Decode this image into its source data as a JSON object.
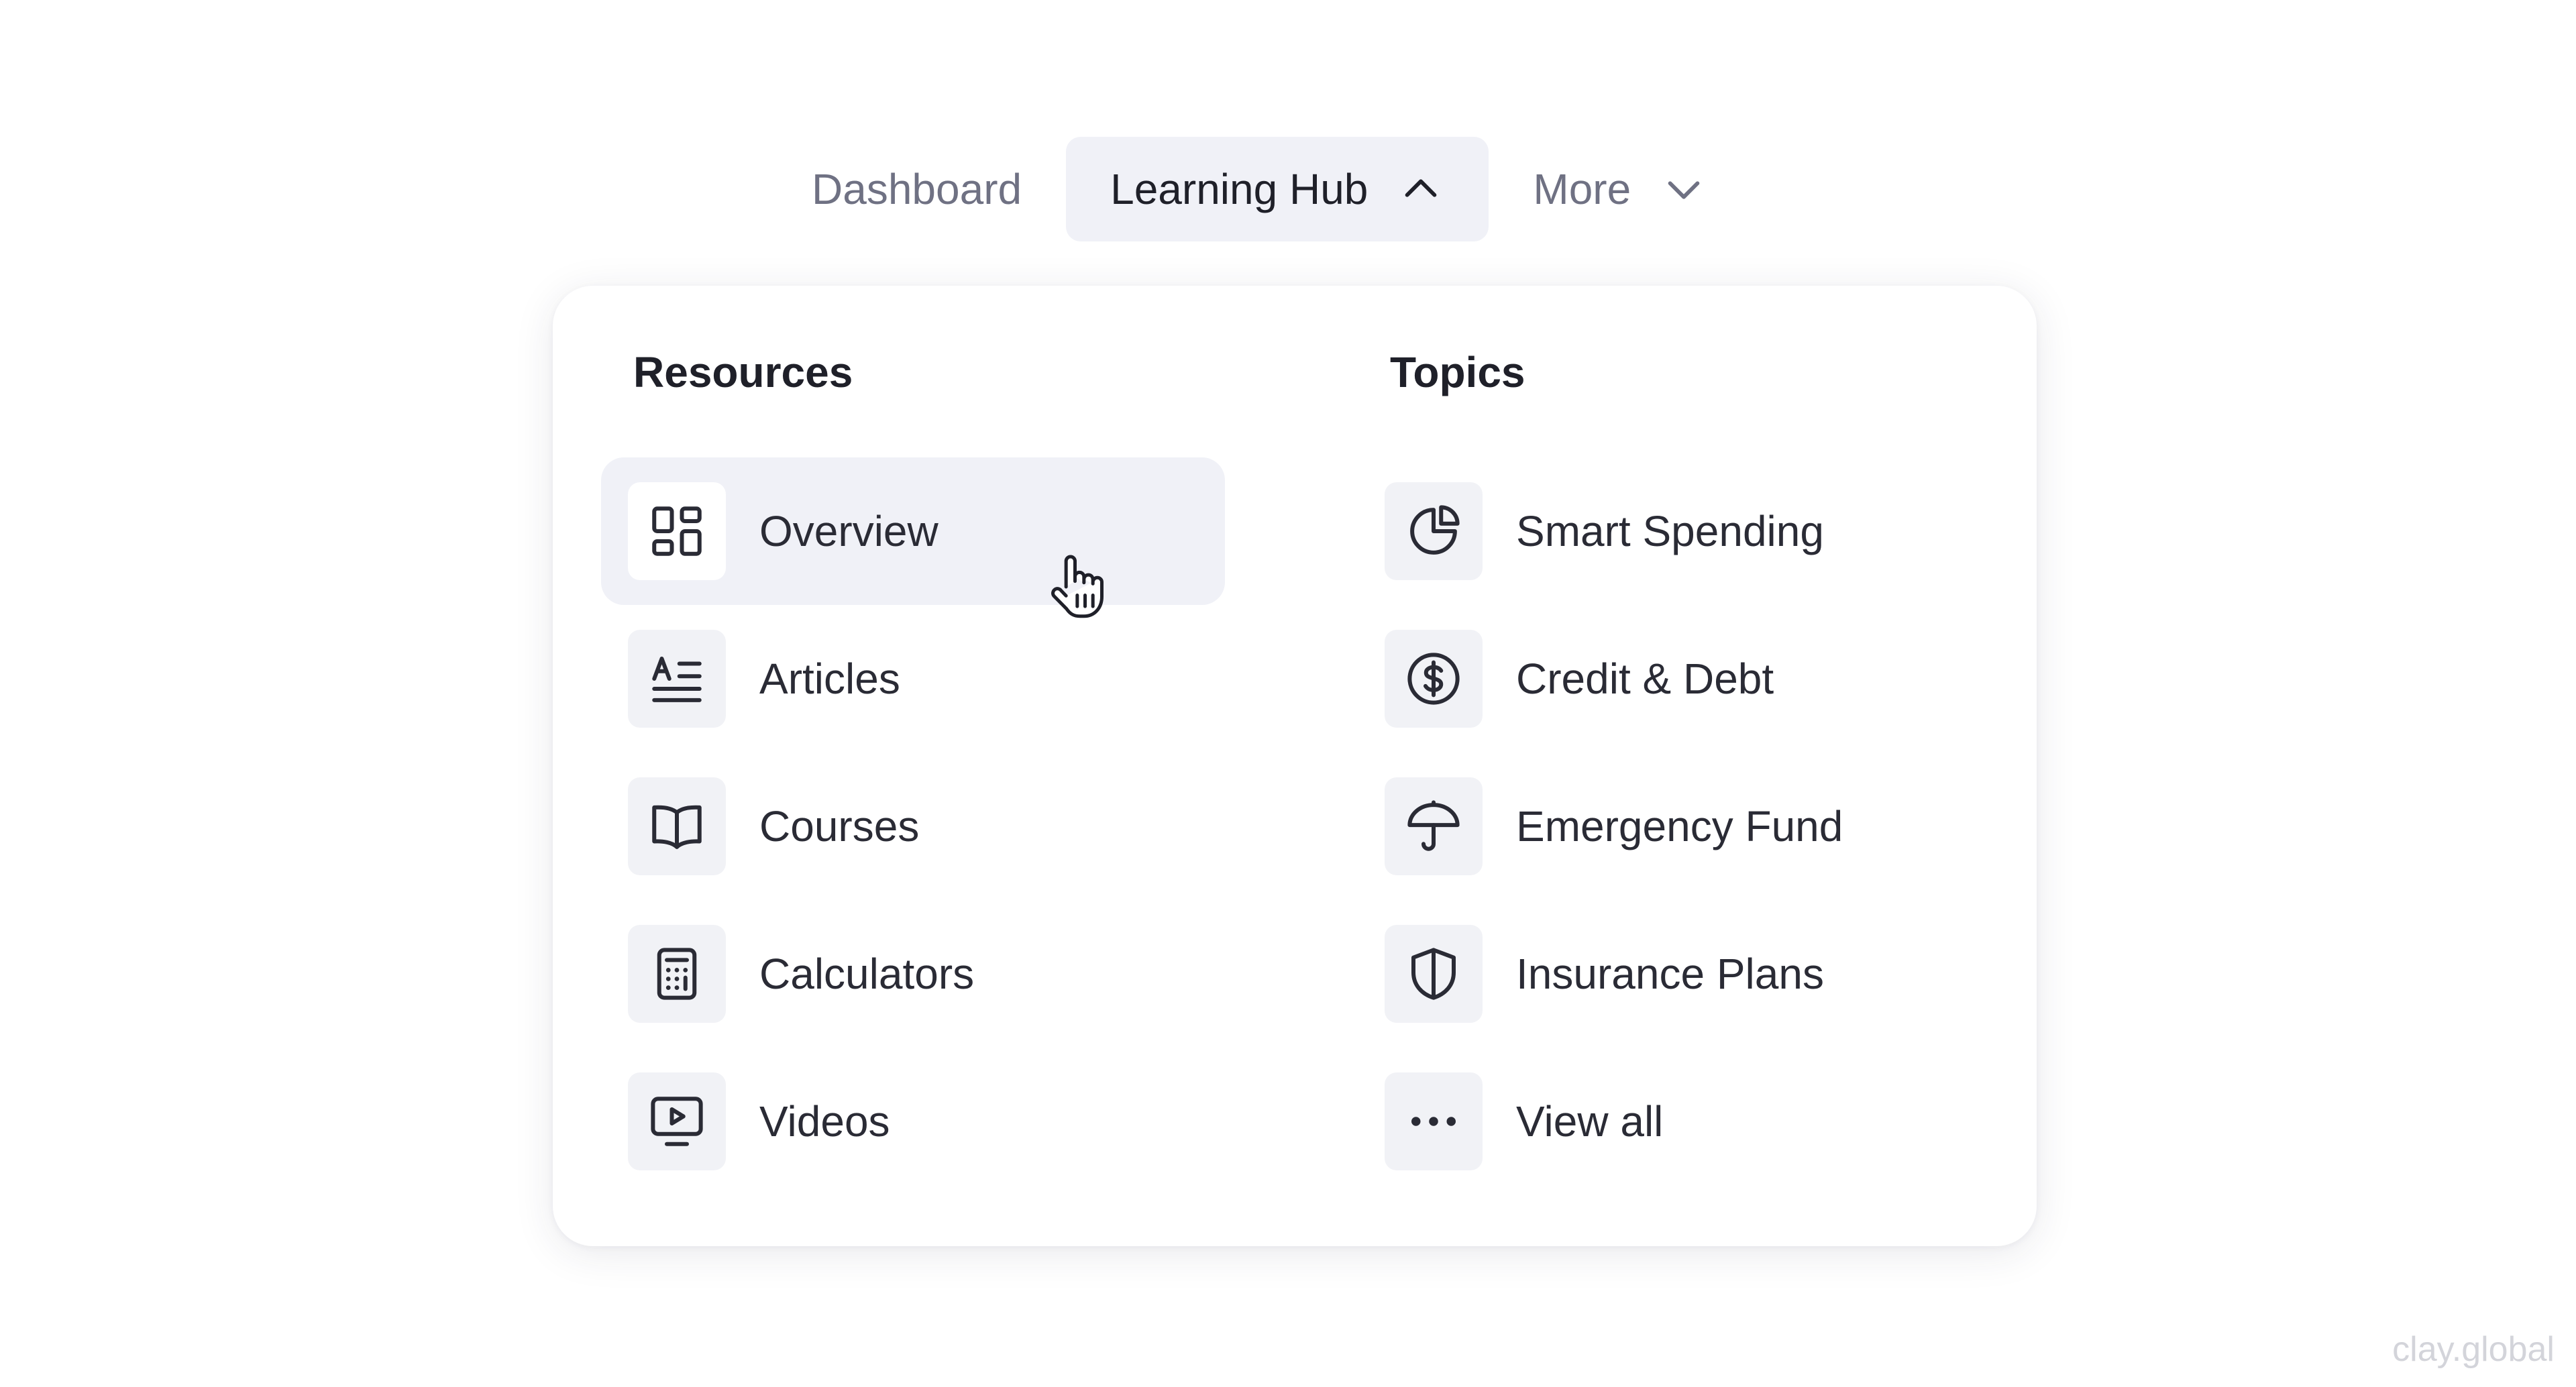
{
  "nav": {
    "items": [
      {
        "label": "Dashboard",
        "state": "default"
      },
      {
        "label": "Learning Hub",
        "state": "open"
      },
      {
        "label": "More",
        "state": "collapsed"
      }
    ]
  },
  "dropdown": {
    "resources": {
      "title": "Resources",
      "items": [
        {
          "label": "Overview",
          "icon": "grid-icon",
          "hovered": true
        },
        {
          "label": "Articles",
          "icon": "text-lines-icon"
        },
        {
          "label": "Courses",
          "icon": "open-book-icon"
        },
        {
          "label": "Calculators",
          "icon": "calculator-icon"
        },
        {
          "label": "Videos",
          "icon": "video-monitor-icon"
        }
      ]
    },
    "topics": {
      "title": "Topics",
      "items": [
        {
          "label": "Smart Spending",
          "icon": "pie-chart-icon"
        },
        {
          "label": "Credit & Debt",
          "icon": "dollar-circle-icon"
        },
        {
          "label": "Emergency Fund",
          "icon": "umbrella-icon"
        },
        {
          "label": "Insurance Plans",
          "icon": "shield-icon"
        },
        {
          "label": "View all",
          "icon": "more-dots-icon"
        }
      ]
    }
  },
  "colors": {
    "text_primary": "#1f2029",
    "text_muted": "#6f7183",
    "active_bg": "#f0f1f7",
    "icon_bg": "#f1f2f6"
  },
  "watermark": "clay.global"
}
